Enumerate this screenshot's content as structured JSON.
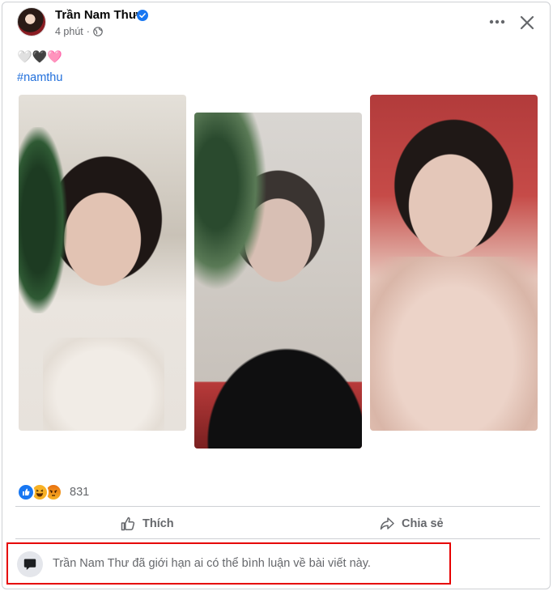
{
  "post": {
    "author": "Trần Nam Thư",
    "time": "4 phút",
    "emojis": "🤍🖤🩷",
    "hashtag": "#namthu"
  },
  "reactions": {
    "count": "831",
    "types": [
      "like-icon",
      "haha-icon",
      "angry-icon"
    ]
  },
  "actions": {
    "like": "Thích",
    "share": "Chia sẻ"
  },
  "comments": {
    "restricted_notice": "Trần Nam Thư đã giới hạn ai có thể bình luận về bài viết này."
  },
  "colors": {
    "brand": "#1877f2",
    "text_secondary": "#65676b",
    "highlight_border": "#e60000",
    "hashtag": "#216fdb"
  }
}
